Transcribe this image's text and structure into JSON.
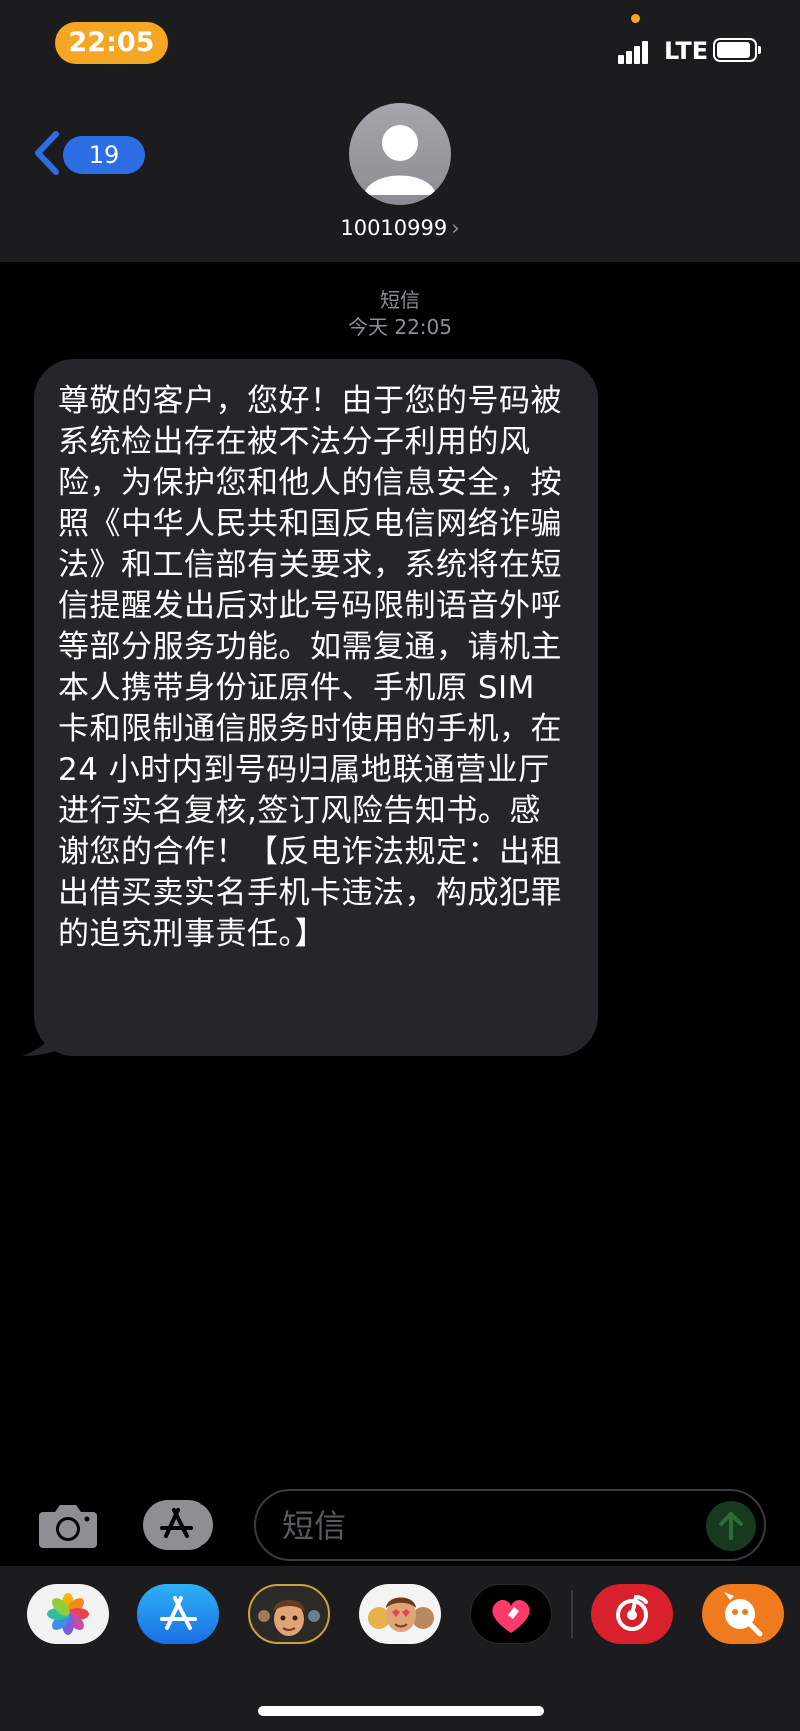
{
  "status_bar": {
    "time": "22:05",
    "network": "LTE"
  },
  "header": {
    "back_badge": "19",
    "contact_name": "10010999",
    "contact_chevron": "›"
  },
  "conversation": {
    "service_label": "短信",
    "timestamp": "今天 22:05",
    "message": "尊敬的客户，您好！由于您的号码被系统检出存在被不法分子利用的风险，为保护您和他人的信息安全，按照《中华人民共和国反电信网络诈骗法》和工信部有关要求，系统将在短信提醒发出后对此号码限制语音外呼等部分服务功能。如需复通，请机主本人携带身份证原件、手机原 SIM 卡和限制通信服务时使用的手机，在 24 小时内到号码归属地联通营业厅进行实名复核,签订风险告知书。感谢您的合作！【反电诈法规定：出租出借买卖实名手机卡违法，构成犯罪的追究刑事责任。】"
  },
  "input_bar": {
    "placeholder": "短信",
    "icons": {
      "camera": "camera-icon",
      "appstore": "appstore-icon",
      "send": "arrow-up-icon"
    }
  },
  "app_drawer": {
    "apps": [
      "photos",
      "app-store",
      "memoji",
      "memoji-stickers",
      "digital-touch",
      "netease-music",
      "weibo-like"
    ]
  },
  "colors": {
    "header_bg": "#1c1c1e",
    "bubble_bg": "#26252a",
    "badge_blue": "#2d6ee5",
    "time_pill": "#f5a623",
    "meta_gray": "#8e8e93"
  }
}
